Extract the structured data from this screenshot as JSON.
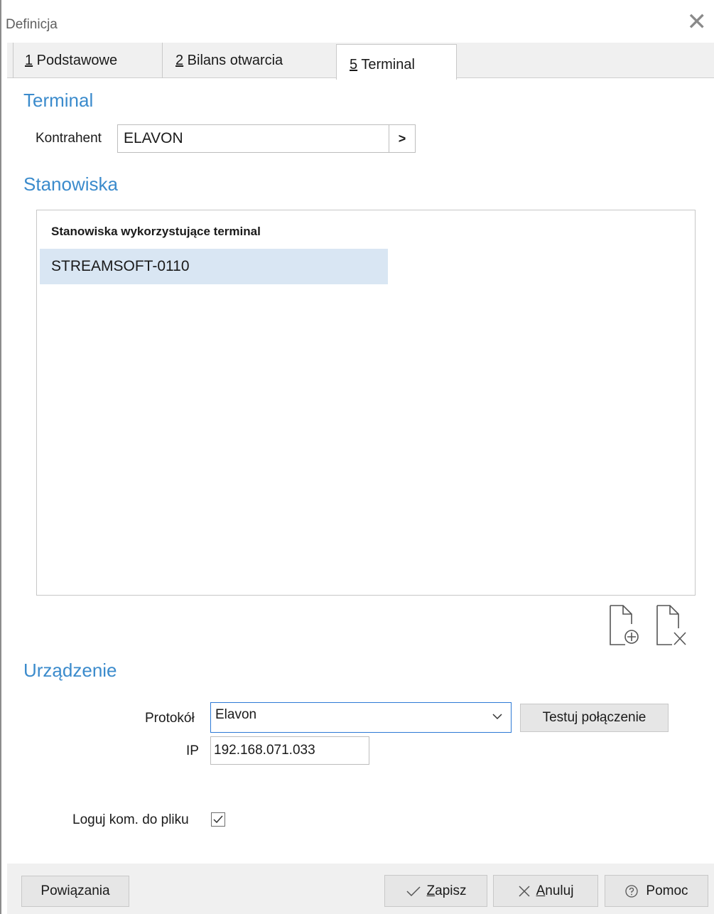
{
  "window": {
    "title": "Definicja"
  },
  "tabs": [
    {
      "num": "1",
      "label": " Podstawowe"
    },
    {
      "num": "2",
      "label": " Bilans otwarcia"
    },
    {
      "num": "5",
      "label": " Terminal"
    }
  ],
  "terminal": {
    "section_title": "Terminal",
    "kontrahent_label": "Kontrahent",
    "kontrahent_value": "ELAVON",
    "select_button": ">"
  },
  "stanowiska": {
    "section_title": "Stanowiska",
    "column_header": "Stanowiska wykorzystujące terminal",
    "rows": [
      "STREAMSOFT-0110"
    ]
  },
  "urzadzenie": {
    "section_title": "Urządzenie",
    "protokol_label": "Protokół",
    "protokol_value": "Elavon",
    "test_button": "Testuj połączenie",
    "ip_label": "IP",
    "ip_value": "192.168.071.033",
    "log_label": "Loguj kom. do pliku",
    "log_checked": true
  },
  "footer": {
    "powiazania": "Powiązania",
    "zapisz_key": "Z",
    "zapisz_rest": "apisz",
    "anuluj_key": "A",
    "anuluj_rest": "nuluj",
    "pomoc": "Pomoc"
  },
  "icons": {
    "close": "close-icon",
    "add_doc": "document-add-icon",
    "delete_doc": "document-delete-icon",
    "chevron": "chevron-down-icon",
    "check": "check-icon",
    "help": "help-icon"
  }
}
